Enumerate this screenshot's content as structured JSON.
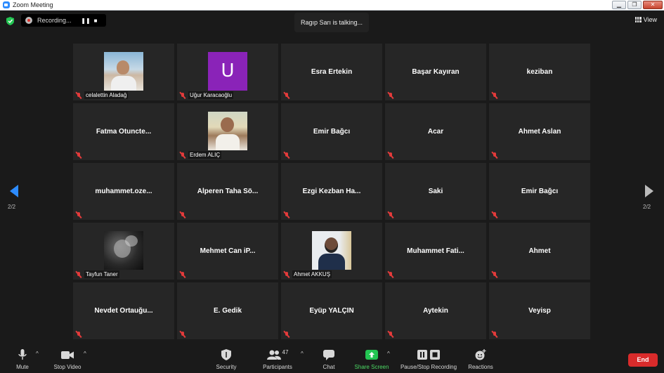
{
  "window": {
    "title": "Zoom Meeting",
    "minimize": "▁",
    "restore": "❐",
    "close": "✕"
  },
  "top_bar": {
    "recording_label": "Recording...",
    "pause_glyph": "❚❚",
    "stop_glyph": "■",
    "talking_text": "Ragıp Sarı is talking...",
    "view_label": "View"
  },
  "pager": {
    "left_page": "2/2",
    "right_page": "2/2"
  },
  "tiles": [
    {
      "name": "celalettin Aladağ",
      "center_text": "",
      "photo": "photo-celal",
      "label": "celalettin Aladağ"
    },
    {
      "name": "Uğur Karacaoğlu",
      "center_text": "",
      "photo": "avatar-u",
      "avatar_letter": "U",
      "label": "Uğur Karacaoğlu"
    },
    {
      "name": "Esra Ertekin",
      "center_text": "Esra Ertekin",
      "label": ""
    },
    {
      "name": "Başar Kayıran",
      "center_text": "Başar Kayıran",
      "label": ""
    },
    {
      "name": "keziban",
      "center_text": "keziban",
      "label": ""
    },
    {
      "name": "Fatma Otuncte...",
      "center_text": "Fatma  Otuncte...",
      "label": ""
    },
    {
      "name": "Erdem ALIÇ",
      "center_text": "",
      "photo": "photo-erdem",
      "label": "Erdem ALIÇ"
    },
    {
      "name": "Emir Bağcı",
      "center_text": "Emir Bağcı",
      "label": ""
    },
    {
      "name": "Acar",
      "center_text": "Acar",
      "label": ""
    },
    {
      "name": "Ahmet Aslan",
      "center_text": "Ahmet Aslan",
      "label": ""
    },
    {
      "name": "muhammet.oze...",
      "center_text": "muhammet.oze...",
      "label": ""
    },
    {
      "name": "Alperen Taha Sö...",
      "center_text": "Alperen  Taha  Sö...",
      "label": ""
    },
    {
      "name": "Ezgi Kezban Ha...",
      "center_text": "Ezgi  Kezban  Ha...",
      "label": ""
    },
    {
      "name": "Saki",
      "center_text": "Saki",
      "label": ""
    },
    {
      "name": "Emir Bağcı",
      "center_text": "Emir Bağcı",
      "label": ""
    },
    {
      "name": "Tayfun Taner",
      "center_text": "",
      "photo": "photo-tayfun",
      "label": "Tayfun Taner"
    },
    {
      "name": "Mehmet Can iP...",
      "center_text": "Mehmet  Can  iP...",
      "label": ""
    },
    {
      "name": "Ahmet AKKUŞ",
      "center_text": "",
      "photo": "photo-ahmet",
      "label": "Ahmet AKKUŞ"
    },
    {
      "name": "Muhammet Fati...",
      "center_text": "Muhammet  Fati...",
      "label": ""
    },
    {
      "name": "Ahmet",
      "center_text": "Ahmet",
      "label": ""
    },
    {
      "name": "Nevdet Ortauğu...",
      "center_text": "Nevdet  Ortauğu...",
      "label": ""
    },
    {
      "name": "E. Gedik",
      "center_text": "E. Gedik",
      "label": ""
    },
    {
      "name": "Eyüp YALÇIN",
      "center_text": "Eyüp YALÇIN",
      "label": ""
    },
    {
      "name": "Aytekin",
      "center_text": "Aytekin",
      "label": ""
    },
    {
      "name": "Veyisp",
      "center_text": "Veyisp",
      "label": ""
    }
  ],
  "toolbar": {
    "mute": "Mute",
    "stop_video": "Stop Video",
    "security": "Security",
    "participants": "Participants",
    "participants_count": "47",
    "chat": "Chat",
    "share_screen": "Share Screen",
    "pause_stop_recording": "Pause/Stop Recording",
    "reactions": "Reactions",
    "end": "End",
    "caret": "^"
  },
  "colors": {
    "background": "#1a1a1a",
    "tile": "#262626",
    "accent_blue": "#2d8cff",
    "share_green": "#4cd964",
    "end_red": "#d92b2b",
    "muted_red": "#e33b3b",
    "avatar_purple": "#8a23b8"
  }
}
